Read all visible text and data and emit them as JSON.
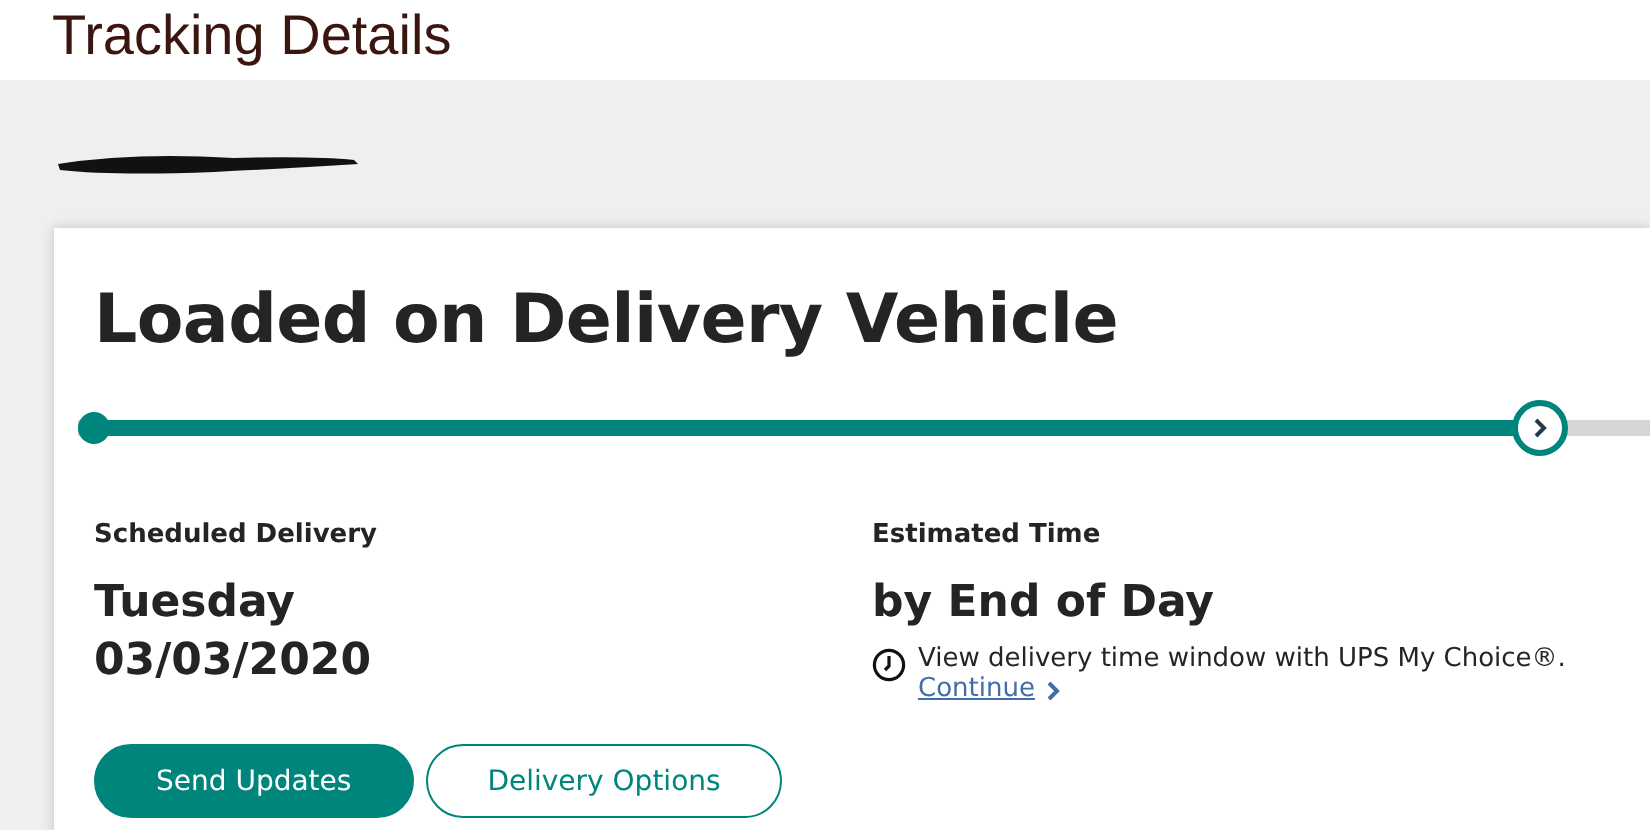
{
  "page": {
    "title": "Tracking Details"
  },
  "shipment": {
    "status": "Loaded on Delivery Vehicle",
    "progress": {
      "level": 0.93
    },
    "details": [
      {
        "label": "Scheduled Delivery",
        "value": "Tuesday",
        "value_2": "03/03/2020"
      },
      {
        "label": "Estimated Time",
        "value": "by End of Day",
        "note": "View delivery time window with UPS My Choice®.",
        "link": "Continue"
      }
    ],
    "buttons": [
      {
        "label": "Send Updates",
        "kind": "primary"
      },
      {
        "label": "Delivery Options",
        "kind": "outline"
      }
    ]
  }
}
